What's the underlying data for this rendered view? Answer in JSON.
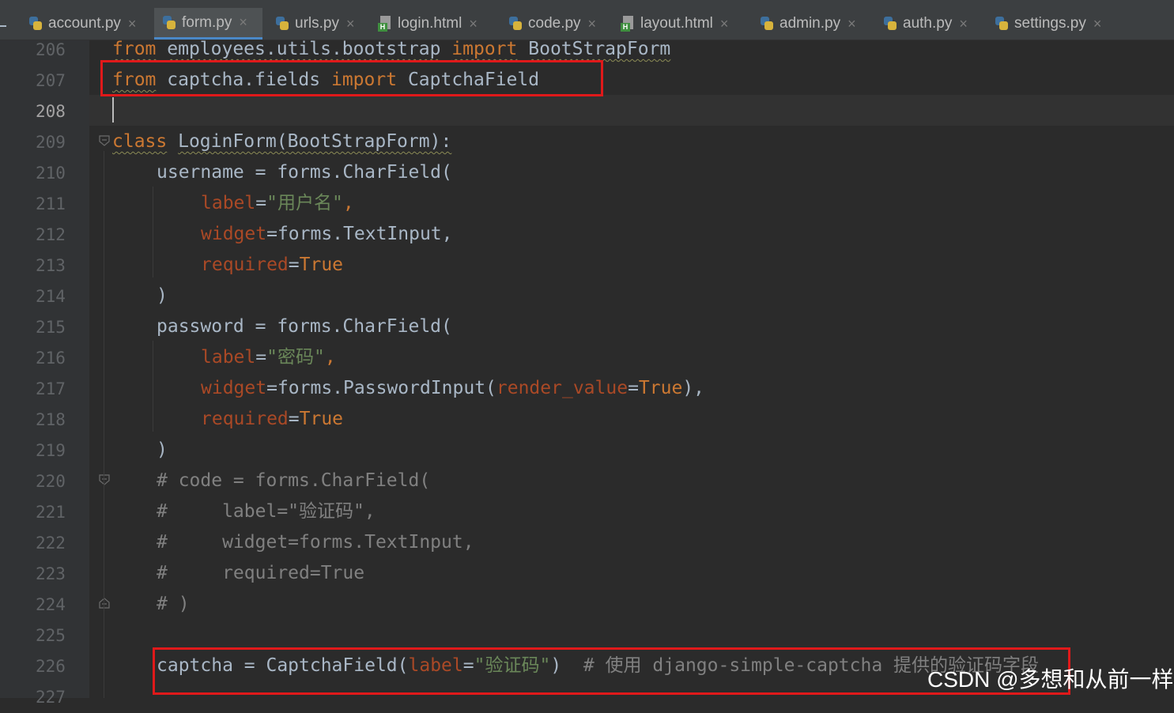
{
  "tabs": [
    {
      "label": "account.py",
      "type": "py"
    },
    {
      "label": "form.py",
      "type": "py",
      "active": true
    },
    {
      "label": "urls.py",
      "type": "py"
    },
    {
      "label": "login.html",
      "type": "html"
    },
    {
      "label": "code.py",
      "type": "py"
    },
    {
      "label": "layout.html",
      "type": "html"
    },
    {
      "label": "admin.py",
      "type": "py"
    },
    {
      "label": "auth.py",
      "type": "py"
    },
    {
      "label": "settings.py",
      "type": "py"
    }
  ],
  "close_glyph": "×",
  "editor": {
    "current_line": "208",
    "line_numbers": [
      "206",
      "207",
      "208",
      "209",
      "210",
      "211",
      "212",
      "213",
      "214",
      "215",
      "216",
      "217",
      "218",
      "219",
      "220",
      "221",
      "222",
      "223",
      "224",
      "225",
      "226",
      "227"
    ]
  },
  "code": {
    "l206": [
      "from",
      " ",
      "employees.utils.bootstrap",
      " ",
      "import",
      " ",
      "BootStrapForm"
    ],
    "l207": [
      "from",
      " ",
      "captcha.fields",
      " ",
      "import",
      " ",
      "CaptchaField"
    ],
    "l209": [
      "class",
      " ",
      "LoginForm(BootStrapForm):"
    ],
    "l210": [
      "username = forms.CharField("
    ],
    "l211": [
      "label",
      "=",
      "\"用户名\"",
      ","
    ],
    "l212": [
      "widget",
      "=forms.TextInput,"
    ],
    "l213": [
      "required",
      "=",
      "True"
    ],
    "l214": [
      ")"
    ],
    "l215": [
      "password = forms.CharField("
    ],
    "l216": [
      "label",
      "=",
      "\"密码\"",
      ","
    ],
    "l217": [
      "widget",
      "=forms.PasswordInput(",
      "render_value",
      "=",
      "True",
      "),"
    ],
    "l218": [
      "required",
      "=",
      "True"
    ],
    "l219": [
      ")"
    ],
    "l220": [
      "# code = forms.CharField("
    ],
    "l221": [
      "#     label=\"验证码\","
    ],
    "l222": [
      "#     widget=forms.TextInput,"
    ],
    "l223": [
      "#     required=True"
    ],
    "l224": [
      "# )"
    ],
    "l226": [
      "captcha = CaptchaField(",
      "label",
      "=",
      "\"验证码\"",
      ")  ",
      "# 使用 django-simple-captcha 提供的验证码字段"
    ]
  },
  "watermark": "CSDN @多想和从前一样",
  "colors": {
    "keyword": "#cc7832",
    "string": "#6a8759",
    "param": "#aa4926",
    "comment": "#808080",
    "highlight_box": "#e0191a",
    "active_tab_underline": "#4a88c7"
  }
}
